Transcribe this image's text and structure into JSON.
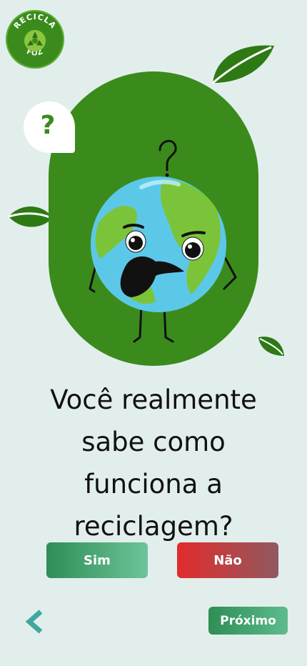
{
  "logo": {
    "line1": "RECICLA",
    "line2": "FOZ"
  },
  "bubble": {
    "symbol": "?"
  },
  "question": {
    "lines": [
      "Você realmente",
      "sabe como",
      "funciona a",
      "reciclagem?"
    ]
  },
  "buttons": {
    "yes": "Sim",
    "no": "Não",
    "next": "Próximo"
  },
  "icons": {
    "back": "chevron-left-icon"
  },
  "colors": {
    "background": "#e2eeec",
    "pill": "#3a8b1c",
    "yes": "#2f8d55",
    "no": "#e22b2c",
    "back": "#3fa8a0"
  }
}
